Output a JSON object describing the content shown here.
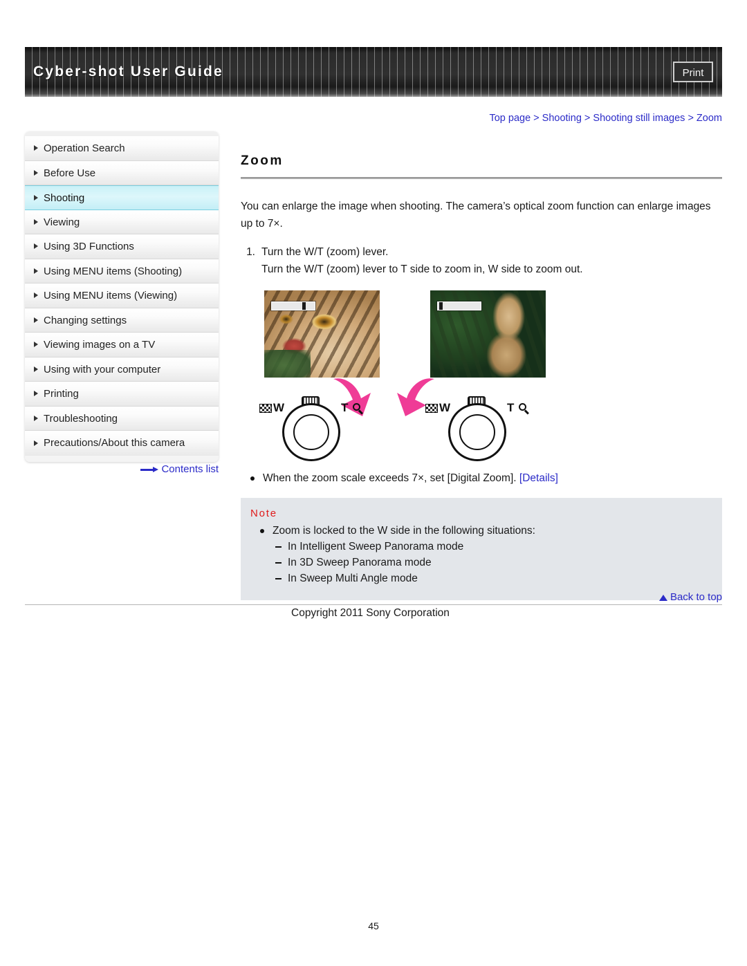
{
  "header": {
    "title": "Cyber-shot User Guide",
    "print_label": "Print"
  },
  "breadcrumb": {
    "full": "Top page > Shooting > Shooting still images > Zoom",
    "items": [
      "Top page",
      "Shooting",
      "Shooting still images",
      "Zoom"
    ],
    "separator": " > ",
    "color": "#2b2bc8"
  },
  "sidebar": {
    "items": [
      {
        "label": "Operation Search",
        "active": false
      },
      {
        "label": "Before Use",
        "active": false
      },
      {
        "label": "Shooting",
        "active": true
      },
      {
        "label": "Viewing",
        "active": false
      },
      {
        "label": "Using 3D Functions",
        "active": false
      },
      {
        "label": "Using MENU items (Shooting)",
        "active": false
      },
      {
        "label": "Using MENU items (Viewing)",
        "active": false
      },
      {
        "label": "Changing settings",
        "active": false
      },
      {
        "label": "Viewing images on a TV",
        "active": false
      },
      {
        "label": "Using with your computer",
        "active": false
      },
      {
        "label": "Printing",
        "active": false
      },
      {
        "label": "Troubleshooting",
        "active": false
      },
      {
        "label": "Precautions/About this camera",
        "active": false
      }
    ],
    "contents_link": "Contents list",
    "active_highlight_color": "#c9f1f7"
  },
  "main": {
    "title": "Zoom",
    "intro": "You can enlarge the image when shooting. The camera’s optical zoom function can enlarge images up to 7×.",
    "steps": [
      {
        "number": "1.",
        "heading": "Turn the W/T (zoom) lever.",
        "detail": "Turn the W/T (zoom) lever to T side to zoom in, W side to zoom out."
      }
    ],
    "figures": {
      "left": {
        "caption_alt": "Zoomed-in cat photo (T side)",
        "lever_w_label": "W",
        "lever_t_label": "T",
        "arrow_direction": "down-right"
      },
      "right": {
        "caption_alt": "Zoomed-out cat photo (W side)",
        "lever_w_label": "W",
        "lever_t_label": "T",
        "arrow_direction": "down-left"
      }
    },
    "detail_bullet": {
      "text_before": "When the zoom scale exceeds 7×, set [Digital Zoom]. ",
      "link": "[Details]"
    },
    "note": {
      "heading": "Note",
      "heading_color": "#e01b1b",
      "bullet": "Zoom is locked to the W side in the following situations:",
      "sub_items": [
        "In Intelligent Sweep Panorama mode",
        "In 3D Sweep Panorama mode",
        "In Sweep Multi Angle mode"
      ],
      "background_color": "#e3e6ea"
    }
  },
  "footer": {
    "back_to_top": "Back to top",
    "copyright": "Copyright 2011 Sony Corporation",
    "page_number": "45"
  }
}
